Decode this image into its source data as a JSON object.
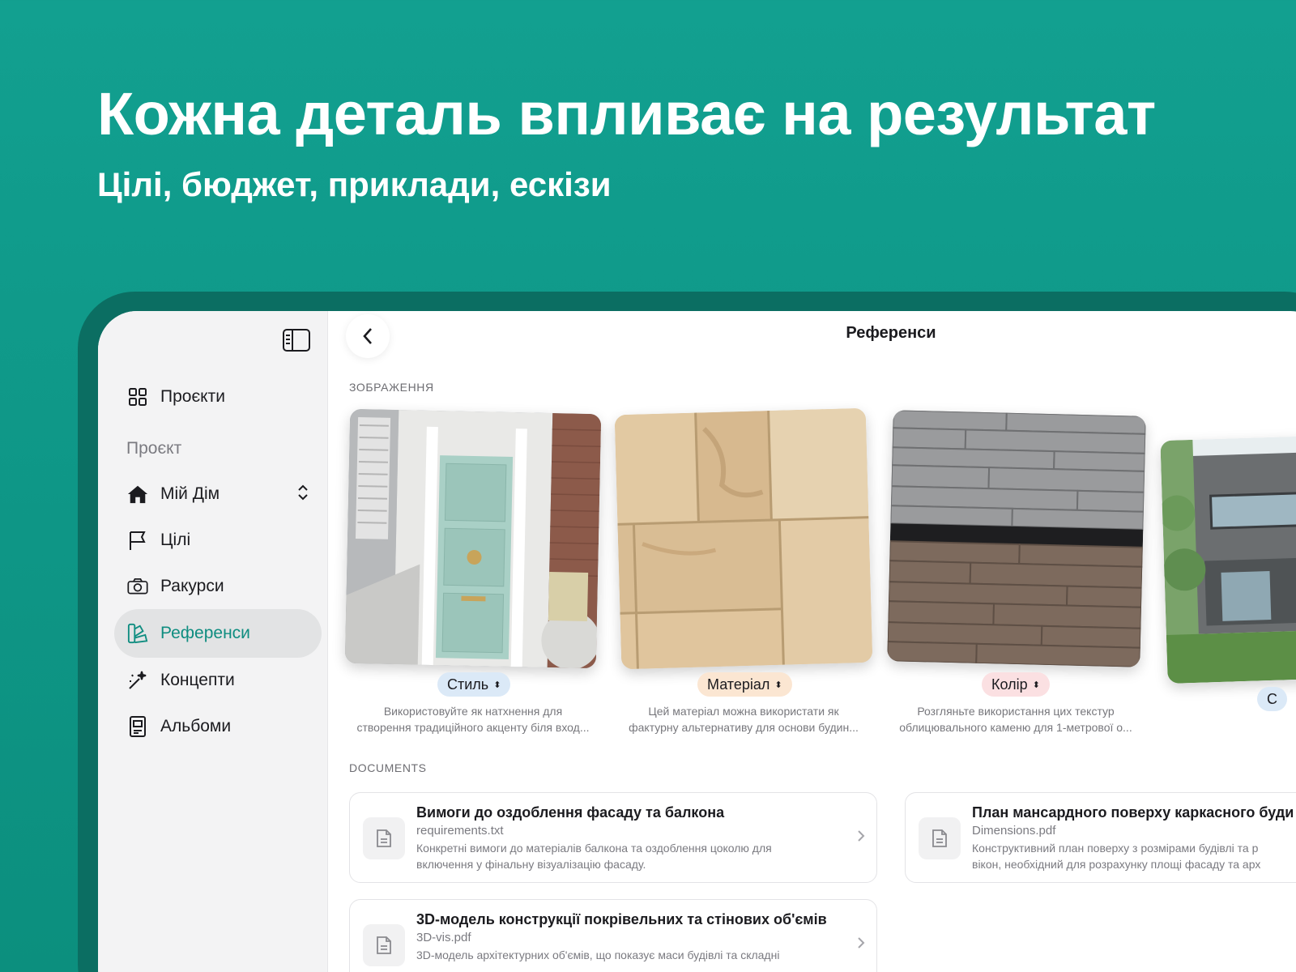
{
  "hero": {
    "title": "Кожна деталь впливає на результат",
    "subtitle": "Цілі, бюджет, приклади, ескізи"
  },
  "sidebar": {
    "section_label": "Проєкт",
    "items": [
      {
        "label": "Проєкти",
        "icon": "grid-icon"
      },
      {
        "label": "Мій Дім",
        "icon": "house-icon"
      },
      {
        "label": "Цілі",
        "icon": "flag-icon"
      },
      {
        "label": "Ракурси",
        "icon": "camera-icon"
      },
      {
        "label": "Референси",
        "icon": "palette-icon",
        "active": true
      },
      {
        "label": "Концепти",
        "icon": "magic-wand-icon"
      },
      {
        "label": "Альбоми",
        "icon": "album-icon"
      }
    ]
  },
  "main": {
    "title": "Референси",
    "images_label": "ЗОБРАЖЕННЯ",
    "documents_label": "DOCUMENTS",
    "images": [
      {
        "tag": "Стиль",
        "tag_bg": "#dbe9f7",
        "tag_color": "#1b1b1f",
        "caption_1": "Використовуйте як натхнення для",
        "caption_2": "створення традиційного акценту біля вход..."
      },
      {
        "tag": "Матеріал",
        "tag_bg": "#fbe6d2",
        "tag_color": "#1b1b1f",
        "caption_1": "Цей матеріал можна використати як",
        "caption_2": "фактурну альтернативу для основи будин..."
      },
      {
        "tag": "Колір",
        "tag_bg": "#fbe0e2",
        "tag_color": "#1b1b1f",
        "caption_1": "Розгляньте використання цих текстур",
        "caption_2": "облицювального каменю для 1-метрової о..."
      },
      {
        "tag": "С",
        "tag_bg": "#dbe9f7",
        "tag_color": "#1b1b1f"
      }
    ],
    "documents": [
      {
        "title": "Вимоги до оздоблення фасаду та балкона",
        "file": "requirements.txt",
        "desc_1": "Конкретні вимоги до матеріалів балкона та оздоблення цоколю для",
        "desc_2": "включення у фінальну візуалізацію фасаду."
      },
      {
        "title": "План мансардного поверху каркасного буди",
        "file": "Dimensions.pdf",
        "desc_1": "Конструктивний план поверху з розмірами будівлі та р",
        "desc_2": "вікон, необхідний для розрахунку площі фасаду та арх"
      },
      {
        "title": "3D-модель конструкції покрівельних та стінових об'ємів",
        "file": "3D-vis.pdf",
        "desc_1": "3D-модель архітектурних об'ємів, що показує маси будівлі та складні",
        "desc_2": ""
      }
    ]
  }
}
